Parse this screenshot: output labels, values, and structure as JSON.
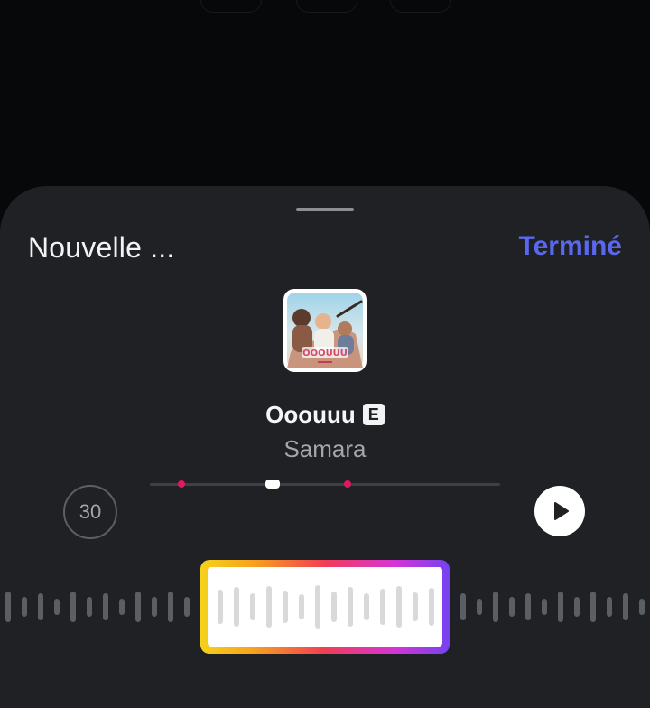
{
  "header": {
    "title": "Nouvelle ...",
    "done_label": "Terminé"
  },
  "track": {
    "title": "Ooouuu",
    "explicit_badge": "E",
    "artist": "Samara",
    "cover_text": "OOOUUU"
  },
  "player": {
    "duration_label": "30",
    "playback_position_fraction": 0.35
  },
  "colors": {
    "accent": "#5a67f0",
    "sheet_background": "#1f2124",
    "marker": "#e0195d"
  },
  "icons": {
    "play": "play-icon",
    "explicit": "explicit-icon"
  }
}
